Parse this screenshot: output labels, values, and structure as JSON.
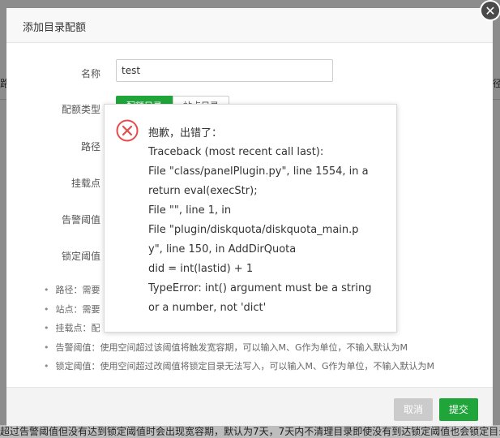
{
  "background": {
    "left_fragment": "路",
    "right_fragment": "径",
    "footer_text": "超过告警阈值但没有达到锁定阈值时会出现宽容期，默认为7天，7天内不清理目录即使没有到达锁定阈值也会锁定目录"
  },
  "modal": {
    "title": "添加目录配额",
    "close_glyph": "✕",
    "form": {
      "name_label": "名称",
      "name_value": "test",
      "type_label": "配额类型",
      "type_option_a": "配额目录",
      "type_option_b": "站点目录",
      "path_label": "路径",
      "mount_label": "挂载点",
      "warn_label": "告警阈值",
      "lock_label": "锁定阈值"
    },
    "tips": [
      "路径：需要",
      "站点：需要",
      "挂载点：配",
      "告警阈值：使用空间超过该阈值将触发宽容期，可以输入M、G作为单位，不输入默认为M",
      "锁定阈值：使用空间超过改阈值将锁定目录无法写入，可以输入M、G作为单位，不输入默认为M"
    ],
    "footer": {
      "cancel_label": "取消",
      "submit_label": "提交"
    }
  },
  "error": {
    "icon": "error-circle-x-icon",
    "title": "抱歉，出错了：",
    "lines": [
      "Traceback (most recent call last):",
      "File \"class/panelPlugin.py\", line 1554, in a",
      "return eval(execStr);",
      "File \"\", line 1, in",
      "File \"plugin/diskquota/diskquota_main.p",
      "y\", line 150, in AddDirQuota",
      "did = int(lastid) + 1",
      "TypeError: int() argument must be a string",
      "or a number, not 'dict'"
    ]
  },
  "colors": {
    "accent_green": "#20a53a",
    "error_red": "#e54b4b",
    "cancel_gray": "#cbcbcb"
  }
}
